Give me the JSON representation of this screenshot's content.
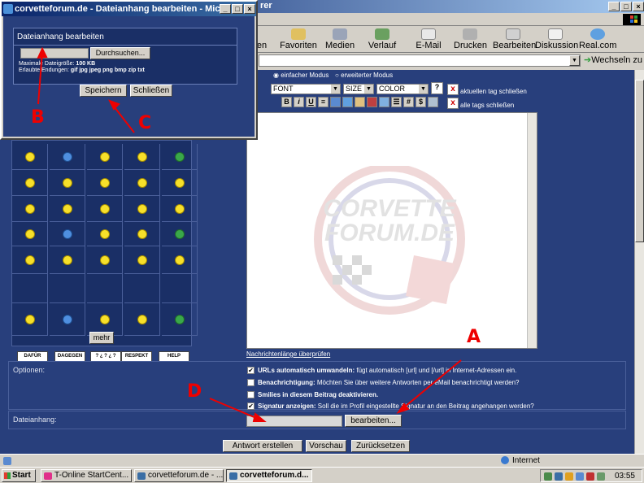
{
  "browser": {
    "title_fragment": "rer",
    "toolbar": [
      "en",
      "Favoriten",
      "Medien",
      "Verlauf",
      "E-Mail",
      "Drucken",
      "Bearbeiten",
      "Diskussion",
      "Real.com"
    ],
    "go_label": "Wechseln zu"
  },
  "editor": {
    "mode_simple": "einfacher Modus",
    "mode_extended": "erweiterter Modus",
    "font": "FONT",
    "size": "SIZE",
    "color": "COLOR",
    "close_tag": "aktuellen tag schließen",
    "close_all": "alle tags schließen",
    "buttons": [
      "B",
      "i",
      "U"
    ],
    "watermark_line1": "CORVETTE",
    "watermark_line2": "FORUM.DE",
    "length_link": "Nachrichtenlänge überprüfen"
  },
  "smilies": {
    "signs": [
      "DAFÜR",
      "DAGEGEN",
      "? ¿ ? ¿ ?",
      "RESPEKT",
      "HELP"
    ],
    "more": "mehr"
  },
  "options": {
    "label": "Optionen:",
    "items": [
      {
        "bold": "URLs automatisch umwandeln:",
        "text": " fügt automatisch [url] und [/url] in Internet-Adressen ein.",
        "checked": true
      },
      {
        "bold": "Benachrichtigung:",
        "text": " Möchten Sie über weitere Antworten per eMail benachrichtigt werden?",
        "checked": false
      },
      {
        "bold": "Smilies in diesem Beitrag deaktivieren.",
        "text": "",
        "checked": false
      },
      {
        "bold": "Signatur anzeigen:",
        "text": " Soll die im Profil eingestellte Signatur an den Beitrag angehangen werden?",
        "checked": true
      }
    ]
  },
  "attachment": {
    "label": "Dateianhang:",
    "edit_button": "bearbeiten..."
  },
  "actions": {
    "submit": "Antwort erstellen",
    "preview": "Vorschau",
    "reset": "Zurücksetzen"
  },
  "status": {
    "zone": "Internet"
  },
  "taskbar": {
    "start": "Start",
    "tasks": [
      "T-Online StartCent...",
      "corvetteforum.de - ...",
      "corvetteforum.d..."
    ],
    "clock": "03:55"
  },
  "dialog": {
    "title": "corvetteforum.de - Dateianhang bearbeiten - Micro...",
    "heading": "Dateianhang bearbeiten",
    "browse": "Durchsuchen...",
    "max_size_label": "Maximale Dateigröße:",
    "max_size_value": "100 KB",
    "allowed_label": "Erlaubte Endungen:",
    "allowed_value": "gif jpg jpeg png bmp zip txt",
    "save": "Speichern",
    "close": "Schließen"
  },
  "annotations": {
    "labels": [
      "A",
      "B",
      "C",
      "D"
    ],
    "color": "#e00000"
  },
  "colors": {
    "page_bg": "#283f7c",
    "panel_bg": "#1a2f66",
    "titlebar": "#0a246a"
  }
}
